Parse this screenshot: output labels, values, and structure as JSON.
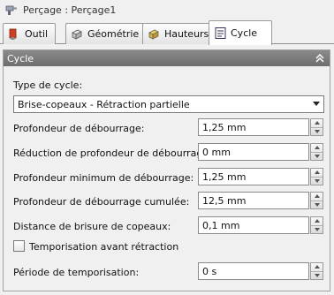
{
  "window": {
    "title": "Perçage : Perçage1",
    "icon": "drill-icon"
  },
  "tabs": [
    {
      "label": "Outil",
      "icon": "tool-icon",
      "active": false
    },
    {
      "label": "Géométrie",
      "icon": "geometry-icon",
      "active": false
    },
    {
      "label": "Hauteurs",
      "icon": "heights-icon",
      "active": false
    },
    {
      "label": "Cycle",
      "icon": "cycle-icon",
      "active": true
    }
  ],
  "panel": {
    "title": "Cycle",
    "cycle_type_label": "Type de cycle:",
    "cycle_type_value": "Brise-copeaux - Rétraction partielle",
    "fields": [
      {
        "label": "Profondeur de débourrage:",
        "value": "1,25 mm"
      },
      {
        "label": "Réduction de profondeur de débourrage:",
        "value": "0 mm"
      },
      {
        "label": "Profondeur minimum de débourrage:",
        "value": "1,25 mm"
      },
      {
        "label": "Profondeur de débourrage cumulée:",
        "value": "12,5 mm"
      },
      {
        "label": "Distance de brisure de copeaux:",
        "value": "0,1 mm"
      }
    ],
    "dwell_checkbox_label": "Temporisation avant rétraction",
    "dwell_checked": false,
    "dwell_period_label": "Période de temporisation:",
    "dwell_period_value": "0 s"
  },
  "colors": {
    "header_bg": "#7a7a7a",
    "tab_active": "#ffffff",
    "background": "#f0f0f0"
  }
}
